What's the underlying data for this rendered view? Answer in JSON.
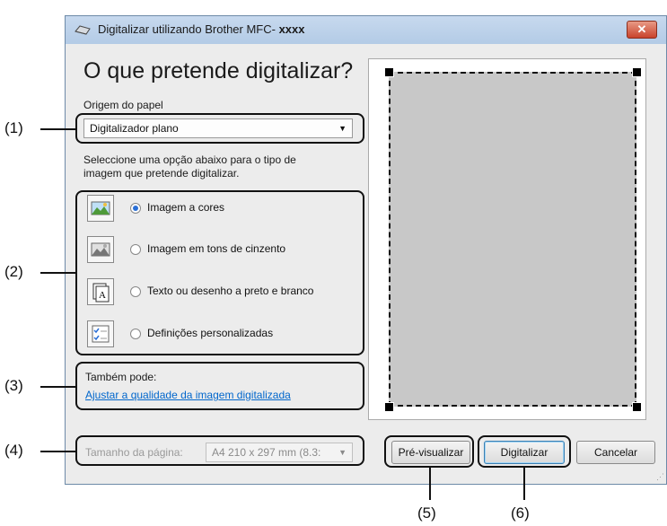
{
  "window": {
    "title": "Digitalizar utilizando Brother MFC-",
    "title_model": "xxxx",
    "close_glyph": "✕"
  },
  "main": {
    "heading": "O que pretende digitalizar?",
    "paper_source_label": "Origem do papel",
    "paper_source_value": "Digitalizador plano",
    "instruction_line1": "Seleccione uma opção abaixo para o tipo de",
    "instruction_line2": "imagem que pretende digitalizar.",
    "options": [
      {
        "label": "Imagem a cores",
        "selected": true,
        "icon": "color-image-icon"
      },
      {
        "label": "Imagem em tons de cinzento",
        "selected": false,
        "icon": "grayscale-image-icon"
      },
      {
        "label": "Texto ou desenho a preto e branco",
        "selected": false,
        "icon": "text-document-icon"
      },
      {
        "label": "Definições personalizadas",
        "selected": false,
        "icon": "custom-settings-icon"
      }
    ],
    "also_label": "Também pode:",
    "adjust_link": "Ajustar a qualidade da imagem digitalizada",
    "page_size_label": "Tamanho da página:",
    "page_size_value": "A4 210 x 297 mm (8.3:"
  },
  "buttons": {
    "preview": "Pré-visualizar",
    "scan": "Digitalizar",
    "cancel": "Cancelar"
  },
  "callouts": [
    "(1)",
    "(2)",
    "(3)",
    "(4)",
    "(5)",
    "(6)"
  ],
  "colors": {
    "accent": "#2a6fd6",
    "link": "#0066cc",
    "preview_area": "#c8c8c8",
    "close": "#c9432c"
  }
}
